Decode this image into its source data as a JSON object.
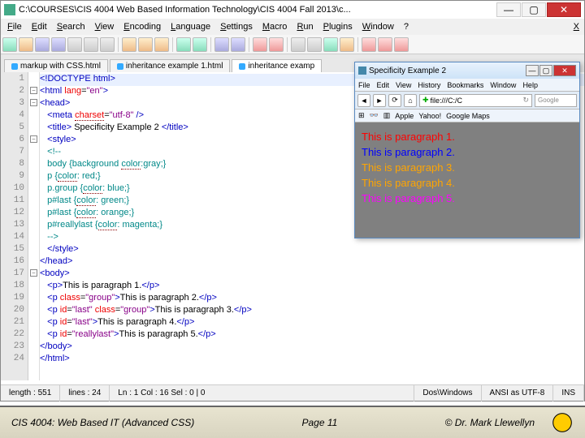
{
  "chart_data": {
    "type": "table",
    "title": "CSS Specificity Example 2 source + rendered result",
    "css_rules": [
      {
        "selector": "body",
        "decl": "background-color: gray;"
      },
      {
        "selector": "p",
        "decl": "color: red;"
      },
      {
        "selector": "p.group",
        "decl": "color: blue;"
      },
      {
        "selector": "p#last",
        "decl": "color: green;"
      },
      {
        "selector": "p#last",
        "decl": "color: orange;"
      },
      {
        "selector": "p#reallylast",
        "decl": "color: magenta;"
      }
    ],
    "rendered_paragraphs": [
      {
        "text": "This is paragraph 1.",
        "color": "red"
      },
      {
        "text": "This is paragraph 2.",
        "color": "blue"
      },
      {
        "text": "This is paragraph 3.",
        "color": "orange"
      },
      {
        "text": "This is paragraph 4.",
        "color": "orange"
      },
      {
        "text": "This is paragraph 5.",
        "color": "magenta"
      }
    ]
  },
  "main": {
    "title": "C:\\COURSES\\CIS 4004   Web Based Information Technology\\CIS 4004   Fall 2013\\c...",
    "menu": [
      "File",
      "Edit",
      "Search",
      "View",
      "Encoding",
      "Language",
      "Settings",
      "Macro",
      "Run",
      "Plugins",
      "Window",
      "?"
    ],
    "tabs": [
      {
        "label": "markup with CSS.html",
        "active": false
      },
      {
        "label": "inheritance example 1.html",
        "active": false
      },
      {
        "label": "inheritance examp",
        "active": true
      }
    ],
    "code": [
      {
        "n": 1,
        "html": "<span class='tag'>&lt;!DOCTYPE html&gt;</span>",
        "caret": true
      },
      {
        "n": 2,
        "html": "<span class='tag'>&lt;html</span> <span class='attr'>lang</span>=<span class='val'>\"en\"</span><span class='tag'>&gt;</span>"
      },
      {
        "n": 3,
        "html": "<span class='tag'>&lt;head&gt;</span>"
      },
      {
        "n": 4,
        "html": "   <span class='tag'>&lt;meta</span> <span class='attr hl-c'>charset</span>=<span class='val'>\"utf-8\"</span> <span class='tag'>/&gt;</span>"
      },
      {
        "n": 5,
        "html": "   <span class='tag'>&lt;title&gt;</span> <span class='txt'>Specificity Example 2</span> <span class='tag'>&lt;/title&gt;</span>"
      },
      {
        "n": 6,
        "html": "   <span class='tag'>&lt;style&gt;</span>"
      },
      {
        "n": 7,
        "html": "   <span class='com'>&lt;!--</span>"
      },
      {
        "n": 8,
        "html": "   <span class='com'>body {background <span class='hl-c'>color</span>:gray;}</span>"
      },
      {
        "n": 9,
        "html": "   <span class='com'>p {<span class='hl-c'>color</span>: red;}</span>"
      },
      {
        "n": 10,
        "html": "   <span class='com'>p.group {<span class='hl-c'>color</span>: blue;}</span>"
      },
      {
        "n": 11,
        "html": "   <span class='com'>p#last {<span class='hl-c'>color</span>: green;}</span>"
      },
      {
        "n": 12,
        "html": "   <span class='com'>p#last {<span class='hl-c'>color</span>: orange;}</span>"
      },
      {
        "n": 13,
        "html": "   <span class='com'>p#reallylast {<span class='hl-c'>color</span>: magenta;}</span>"
      },
      {
        "n": 14,
        "html": "   <span class='com'>--&gt;</span>"
      },
      {
        "n": 15,
        "html": "   <span class='tag'>&lt;/style&gt;</span>"
      },
      {
        "n": 16,
        "html": "<span class='tag'>&lt;/head&gt;</span>"
      },
      {
        "n": 17,
        "html": "<span class='tag'>&lt;body&gt;</span>"
      },
      {
        "n": 18,
        "html": "   <span class='tag'>&lt;p&gt;</span><span class='txt'>This is paragraph 1.</span><span class='tag'>&lt;/p&gt;</span>"
      },
      {
        "n": 19,
        "html": "   <span class='tag'>&lt;p</span> <span class='attr'>class</span>=<span class='val'>\"group\"</span><span class='tag'>&gt;</span><span class='txt'>This is paragraph 2.</span><span class='tag'>&lt;/p&gt;</span>"
      },
      {
        "n": 20,
        "html": "   <span class='tag'>&lt;p</span> <span class='attr'>id</span>=<span class='val'>\"last\"</span> <span class='attr'>class</span>=<span class='val'>\"group\"</span><span class='tag'>&gt;</span><span class='txt'>This is paragraph 3.</span><span class='tag'>&lt;/p&gt;</span>"
      },
      {
        "n": 21,
        "html": "   <span class='tag'>&lt;p</span> <span class='attr'>id</span>=<span class='val'>\"last\"</span><span class='tag'>&gt;</span><span class='txt'>This is paragraph 4.</span><span class='tag'>&lt;/p&gt;</span>"
      },
      {
        "n": 22,
        "html": "   <span class='tag'>&lt;p</span> <span class='attr'>id</span>=<span class='val'>\"reallylast\"</span><span class='tag'>&gt;</span><span class='txt'>This is paragraph 5.</span><span class='tag'>&lt;/p&gt;</span>"
      },
      {
        "n": 23,
        "html": "<span class='tag'>&lt;/body&gt;</span>"
      },
      {
        "n": 24,
        "html": "<span class='tag'>&lt;/html&gt;</span>"
      }
    ],
    "status": {
      "length": "length : 551",
      "lines": "lines : 24",
      "pos": "Ln : 1    Col : 16    Sel : 0 | 0",
      "eol": "Dos\\Windows",
      "enc": "ANSI as UTF-8",
      "mode": "INS"
    }
  },
  "browser": {
    "title": "Specificity Example 2",
    "menu": [
      "File",
      "Edit",
      "View",
      "History",
      "Bookmarks",
      "Window",
      "Help"
    ],
    "url": "file:///C:/C",
    "search_placeholder": "Google",
    "bookmarks": [
      "Apple",
      "Yahoo!",
      "Google Maps"
    ],
    "paras": [
      {
        "text": "This is paragraph 1.",
        "color": "#ff0000"
      },
      {
        "text": "This is paragraph 2.",
        "color": "#0000ff"
      },
      {
        "text": "This is paragraph 3.",
        "color": "#ffa500"
      },
      {
        "text": "This is paragraph 4.",
        "color": "#ffa500"
      },
      {
        "text": "This is paragraph 5.",
        "color": "#ff00ff"
      }
    ]
  },
  "footer": {
    "left": "CIS 4004: Web Based IT (Advanced CSS)",
    "mid": "Page 11",
    "right": "© Dr. Mark Llewellyn"
  }
}
